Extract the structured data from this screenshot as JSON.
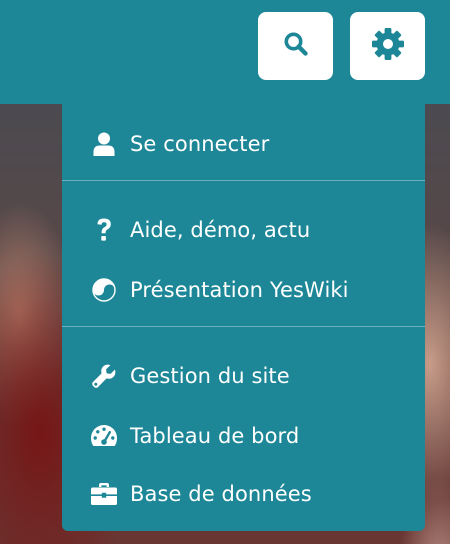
{
  "header": {
    "search_icon": "search-icon",
    "settings_icon": "gear-icon"
  },
  "menu": {
    "sections": [
      {
        "items": [
          {
            "label": "Se connecter",
            "icon": "user-icon"
          }
        ]
      },
      {
        "items": [
          {
            "label": "Aide, démo, actu",
            "icon": "question-icon"
          },
          {
            "label": "Présentation YesWiki",
            "icon": "yin-yang-icon"
          }
        ]
      },
      {
        "items": [
          {
            "label": "Gestion du site",
            "icon": "wrench-icon"
          },
          {
            "label": "Tableau de bord",
            "icon": "dashboard-icon"
          },
          {
            "label": "Base de données",
            "icon": "briefcase-icon"
          }
        ]
      }
    ]
  },
  "colors": {
    "primary": "#1d8798",
    "button_bg": "#ffffff",
    "text": "#ffffff"
  }
}
